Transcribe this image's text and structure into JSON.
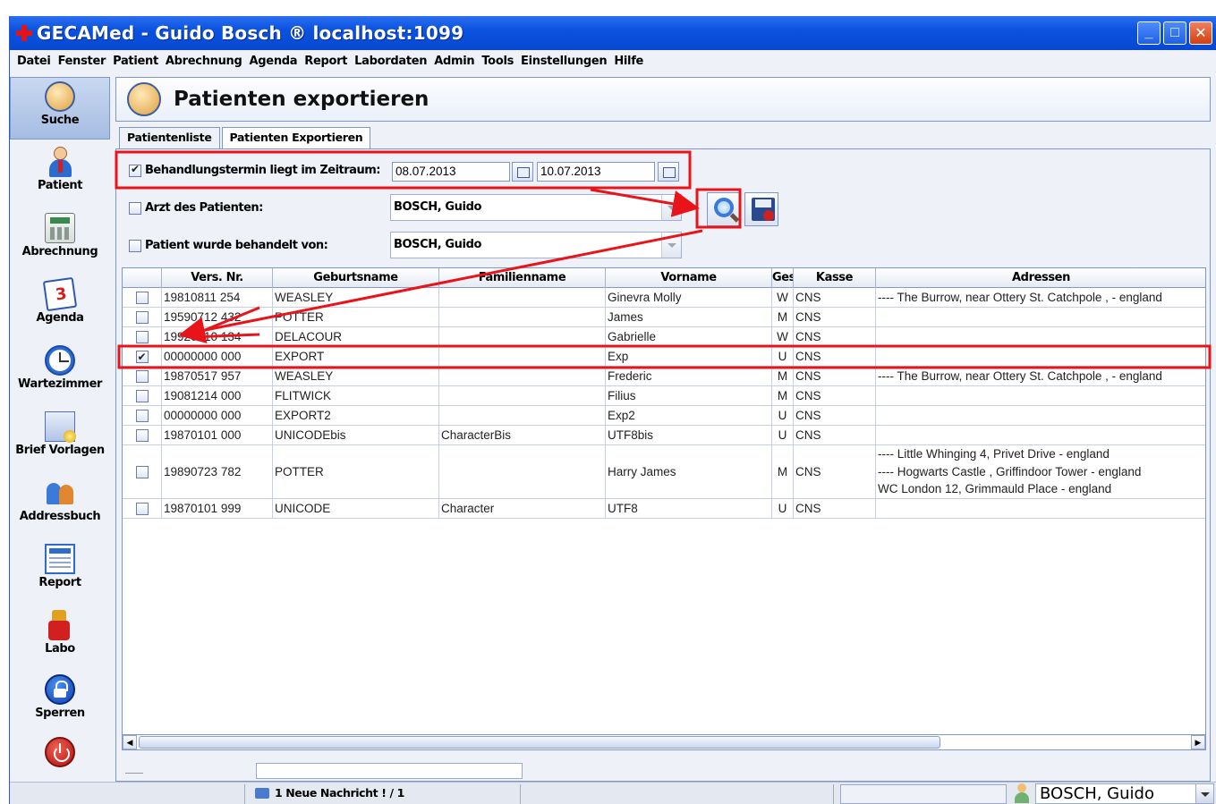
{
  "window": {
    "title": "GECAMed - Guido Bosch ® localhost:1099",
    "buttons": [
      "minimize",
      "maximize",
      "close"
    ]
  },
  "menu": [
    "Datei",
    "Fenster",
    "Patient",
    "Abrechnung",
    "Agenda",
    "Report",
    "Labordaten",
    "Admin",
    "Tools",
    "Einstellungen",
    "Hilfe"
  ],
  "sidebar": {
    "items": [
      {
        "label": "Suche",
        "icon": "patient-search-icon",
        "active": true
      },
      {
        "label": "Patient",
        "icon": "patient-icon"
      },
      {
        "label": "Abrechnung",
        "icon": "calculator-icon"
      },
      {
        "label": "Agenda",
        "icon": "calendar-icon"
      },
      {
        "label": "Wartezimmer",
        "icon": "clock-icon"
      },
      {
        "label": "Brief Vorlagen",
        "icon": "letter-icon"
      },
      {
        "label": "Addressbuch",
        "icon": "addressbook-icon"
      },
      {
        "label": "Report",
        "icon": "report-icon"
      },
      {
        "label": "Labo",
        "icon": "lab-icon"
      },
      {
        "label": "Sperren",
        "icon": "lock-icon"
      },
      {
        "label": "",
        "icon": "power-icon"
      }
    ]
  },
  "header": {
    "title": "Patienten exportieren"
  },
  "tabs": [
    {
      "label": "Patientenliste",
      "active": false
    },
    {
      "label": "Patienten Exportieren",
      "active": true
    }
  ],
  "filters": {
    "date_range": {
      "label": "Behandlungstermin liegt im Zeitraum:",
      "checked": true,
      "from": "08.07.2013",
      "to": "10.07.2013"
    },
    "doctor": {
      "label": "Arzt des Patienten:",
      "checked": false,
      "value": "BOSCH, Guido"
    },
    "treated_by": {
      "label": "Patient wurde behandelt von:",
      "checked": false,
      "value": "BOSCH, Guido"
    }
  },
  "table": {
    "columns": [
      "",
      "Vers. Nr.",
      "Geburtsname",
      "Familienname",
      "Vorname",
      "Ges",
      "Kasse",
      "Adressen"
    ],
    "rows": [
      {
        "checked": false,
        "vers": "19810811 254",
        "geburtsname": "WEASLEY",
        "familienname": "",
        "vorname": "Ginevra Molly",
        "ges": "W",
        "kasse": "CNS",
        "adressen": [
          "---- The Burrow, near Ottery St. Catchpole , - england"
        ]
      },
      {
        "checked": false,
        "vers": "19590712 432",
        "geburtsname": "POTTER",
        "familienname": "",
        "vorname": "James",
        "ges": "M",
        "kasse": "CNS",
        "adressen": []
      },
      {
        "checked": false,
        "vers": "19920910 134",
        "geburtsname": "DELACOUR",
        "familienname": "",
        "vorname": "Gabrielle",
        "ges": "W",
        "kasse": "CNS",
        "adressen": []
      },
      {
        "checked": true,
        "vers": "00000000 000",
        "geburtsname": "EXPORT",
        "familienname": "",
        "vorname": "Exp",
        "ges": "U",
        "kasse": "CNS",
        "adressen": []
      },
      {
        "checked": false,
        "vers": "19870517 957",
        "geburtsname": "WEASLEY",
        "familienname": "",
        "vorname": "Frederic",
        "ges": "M",
        "kasse": "CNS",
        "adressen": [
          "---- The Burrow, near Ottery St. Catchpole , - england"
        ]
      },
      {
        "checked": false,
        "vers": "19081214 000",
        "geburtsname": "FLITWICK",
        "familienname": "",
        "vorname": "Filius",
        "ges": "M",
        "kasse": "CNS",
        "adressen": []
      },
      {
        "checked": false,
        "vers": "00000000 000",
        "geburtsname": "EXPORT2",
        "familienname": "",
        "vorname": "Exp2",
        "ges": "U",
        "kasse": "CNS",
        "adressen": []
      },
      {
        "checked": false,
        "vers": "19870101 000",
        "geburtsname": "UNICODEbis",
        "familienname": "CharacterBis",
        "vorname": "UTF8bis",
        "ges": "U",
        "kasse": "CNS",
        "adressen": []
      },
      {
        "checked": false,
        "vers": "19890723 782",
        "geburtsname": "POTTER",
        "familienname": "",
        "vorname": "Harry James",
        "ges": "M",
        "kasse": "CNS",
        "adressen": [
          "---- Little Whinging 4, Privet Drive - england",
          "---- Hogwarts Castle , Griffindoor Tower - england",
          "WC London 12, Grimmauld Place - england"
        ]
      },
      {
        "checked": false,
        "vers": "19870101 999",
        "geburtsname": "UNICODE",
        "familienname": "Character",
        "vorname": "UTF8",
        "ges": "U",
        "kasse": "CNS",
        "adressen": []
      }
    ]
  },
  "status": {
    "message": "1 Neue Nachricht ! / 1",
    "user": "BOSCH, Guido"
  },
  "colors": {
    "annotation": "#e8141a",
    "titlebar": "#0b52e0",
    "panel_border": "#7d97c8"
  }
}
